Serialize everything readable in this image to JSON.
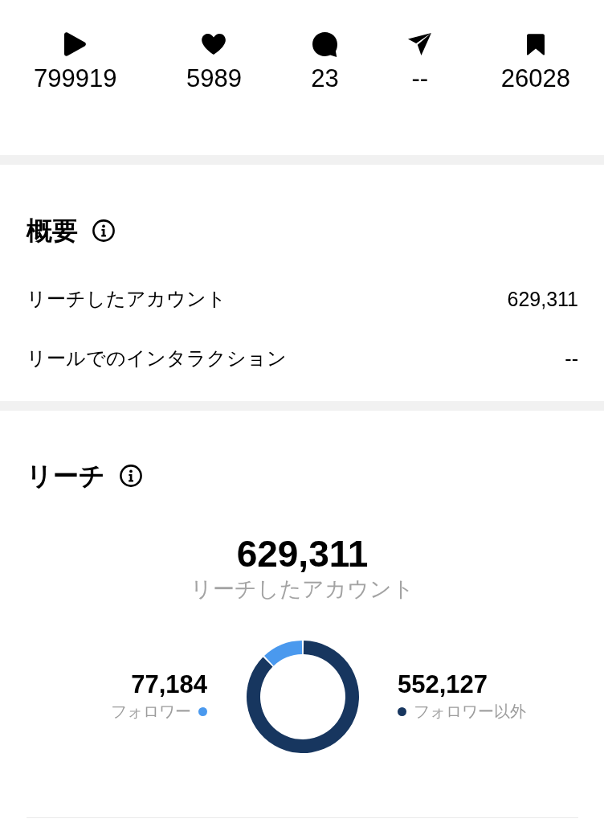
{
  "stats": [
    {
      "kind": "play",
      "value": "799919"
    },
    {
      "kind": "like",
      "value": "5989"
    },
    {
      "kind": "comment",
      "value": "23"
    },
    {
      "kind": "share",
      "value": "--"
    },
    {
      "kind": "save",
      "value": "26028"
    }
  ],
  "overview": {
    "title": "概要",
    "rows": [
      {
        "label": "リーチしたアカウント",
        "value": "629,311"
      },
      {
        "label": "リールでのインタラクション",
        "value": "--"
      }
    ]
  },
  "reach": {
    "title": "リーチ",
    "total": "629,311",
    "total_label": "リーチしたアカウント",
    "legend_values": [
      "77,184",
      "552,127"
    ],
    "chart_data": {
      "type": "donut",
      "categories": [
        "フォロワー",
        "フォロワー以外"
      ],
      "values": [
        12.26,
        87.74
      ],
      "colors": [
        "#4a99ee",
        "#17365f"
      ]
    }
  }
}
